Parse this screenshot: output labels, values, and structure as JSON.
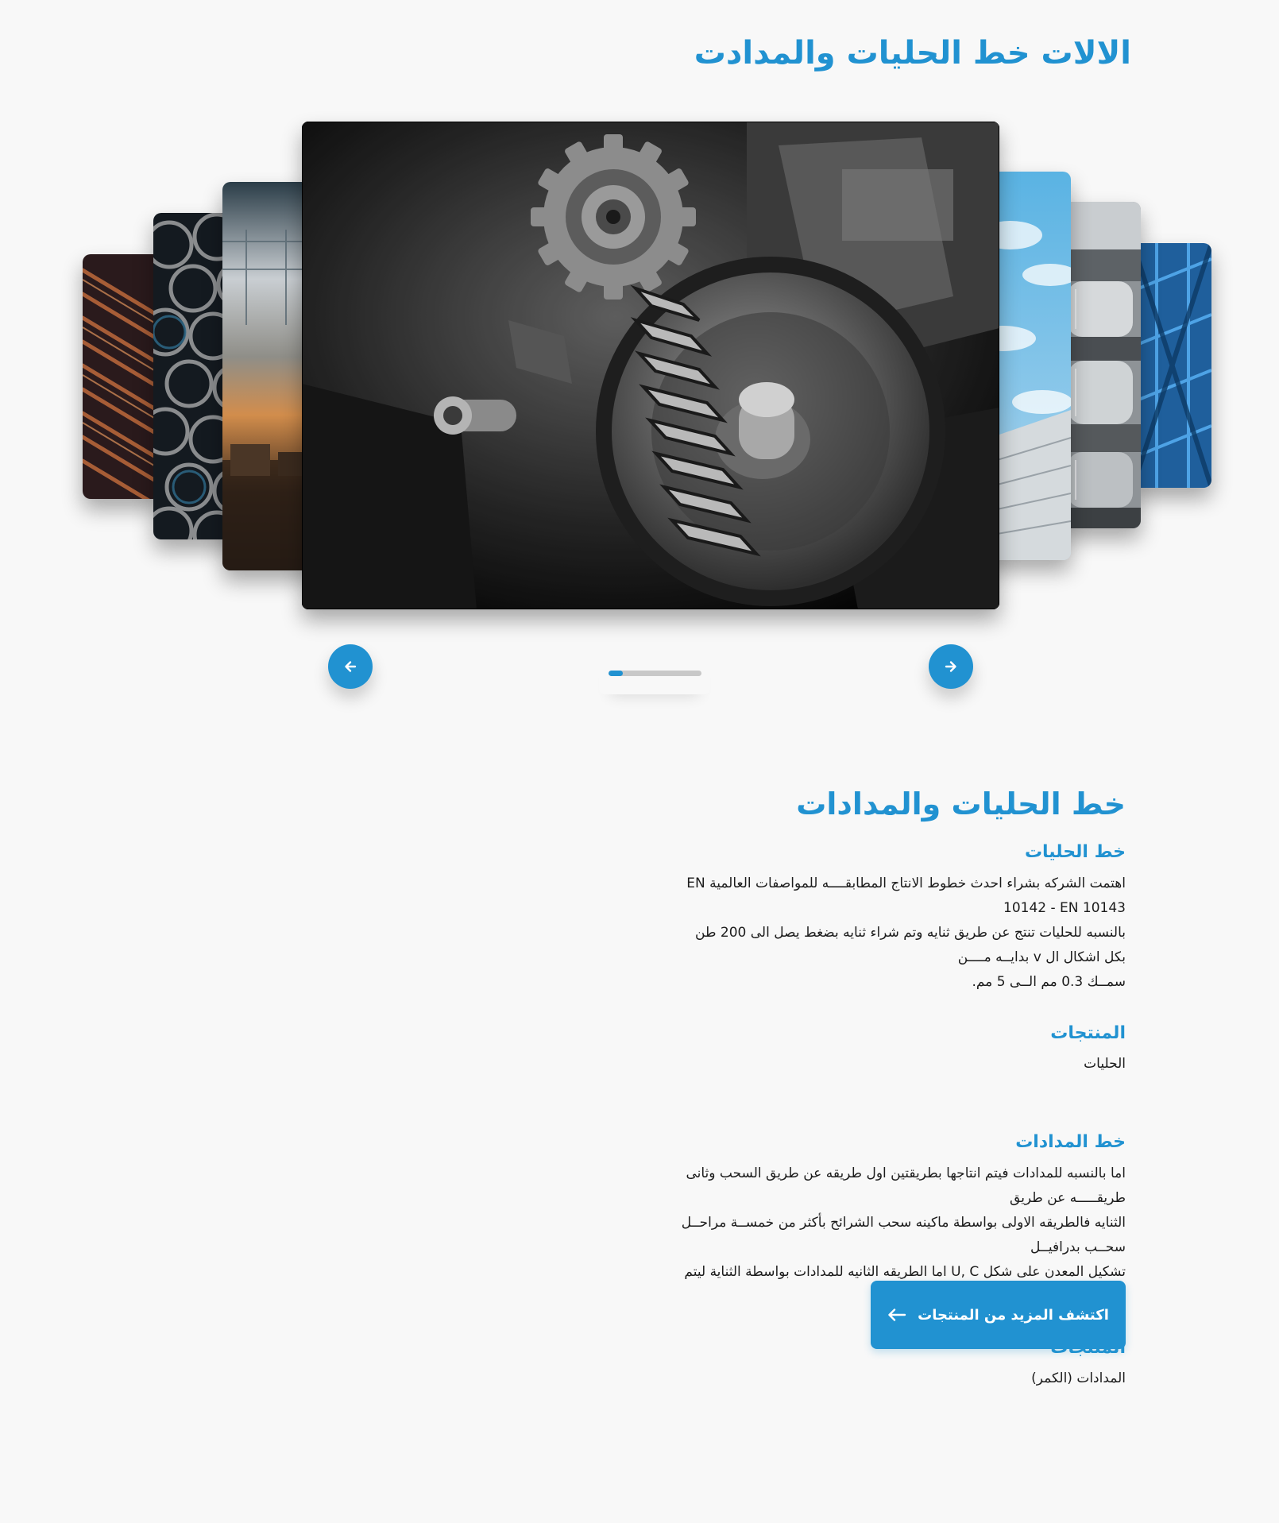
{
  "header": {
    "title": "الالات خط الحليات والمدادت"
  },
  "carousel": {
    "slides": [
      {
        "name": "copper-rebar-image"
      },
      {
        "name": "steel-pipes-image"
      },
      {
        "name": "factory-interior-image"
      },
      {
        "name": "gear-machinery-image"
      },
      {
        "name": "sky-building-image"
      },
      {
        "name": "steel-rollers-image"
      },
      {
        "name": "blue-steel-structure-image"
      }
    ],
    "active_index": 3,
    "progress_fraction": 0.15,
    "prev_icon": "arrow-left-icon",
    "next_icon": "arrow-right-icon"
  },
  "content": {
    "title": "خط الحليات والمدادات",
    "sections": [
      {
        "heading": "خط الحليات",
        "lines": [
          "اهتمت الشركه بشراء احدث خطوط الانتاج المطابقــــه للمواصفات العالمية EN 10142 - EN 10143",
          "بالنسبه للحليات تنتج عن طريق ثنايه وتم شراء ثنايه بضغط يصل الى 200 طن بكل اشكال ال v بدايــه مــــن",
          "سمــك 0.3 مم الــى 5 مم."
        ],
        "products_heading": "المنتجات",
        "products": "الحليات"
      },
      {
        "heading": "خط المدادات",
        "lines": [
          "اما بالنسبه للمدادات فيتم انتاجها بطريقتين اول طريقه عن طريق السحب وثانى طريقـــــه عن طريق",
          "الثنايه فالطريقه الاولى بواسطة ماكينه سحب الشرائح بأكثر من خمســة مراحــل سحــب بدرافيــل",
          "تشكيل المعدن على شكل U, C اما الطريقه الثانيه للمدادات بواسطة الثناية ليتم انتاج الـ L,Z"
        ],
        "products_heading": "المنتجات",
        "products": "المدادات (الكمر)"
      }
    ]
  },
  "cta": {
    "label": "اكتشف المزيد من المنتجات",
    "icon": "arrow-left-icon"
  },
  "colors": {
    "accent": "#2192d1",
    "background": "#f8f8f8",
    "text": "#1c1c1c",
    "progress_track": "#c8c8c8"
  }
}
